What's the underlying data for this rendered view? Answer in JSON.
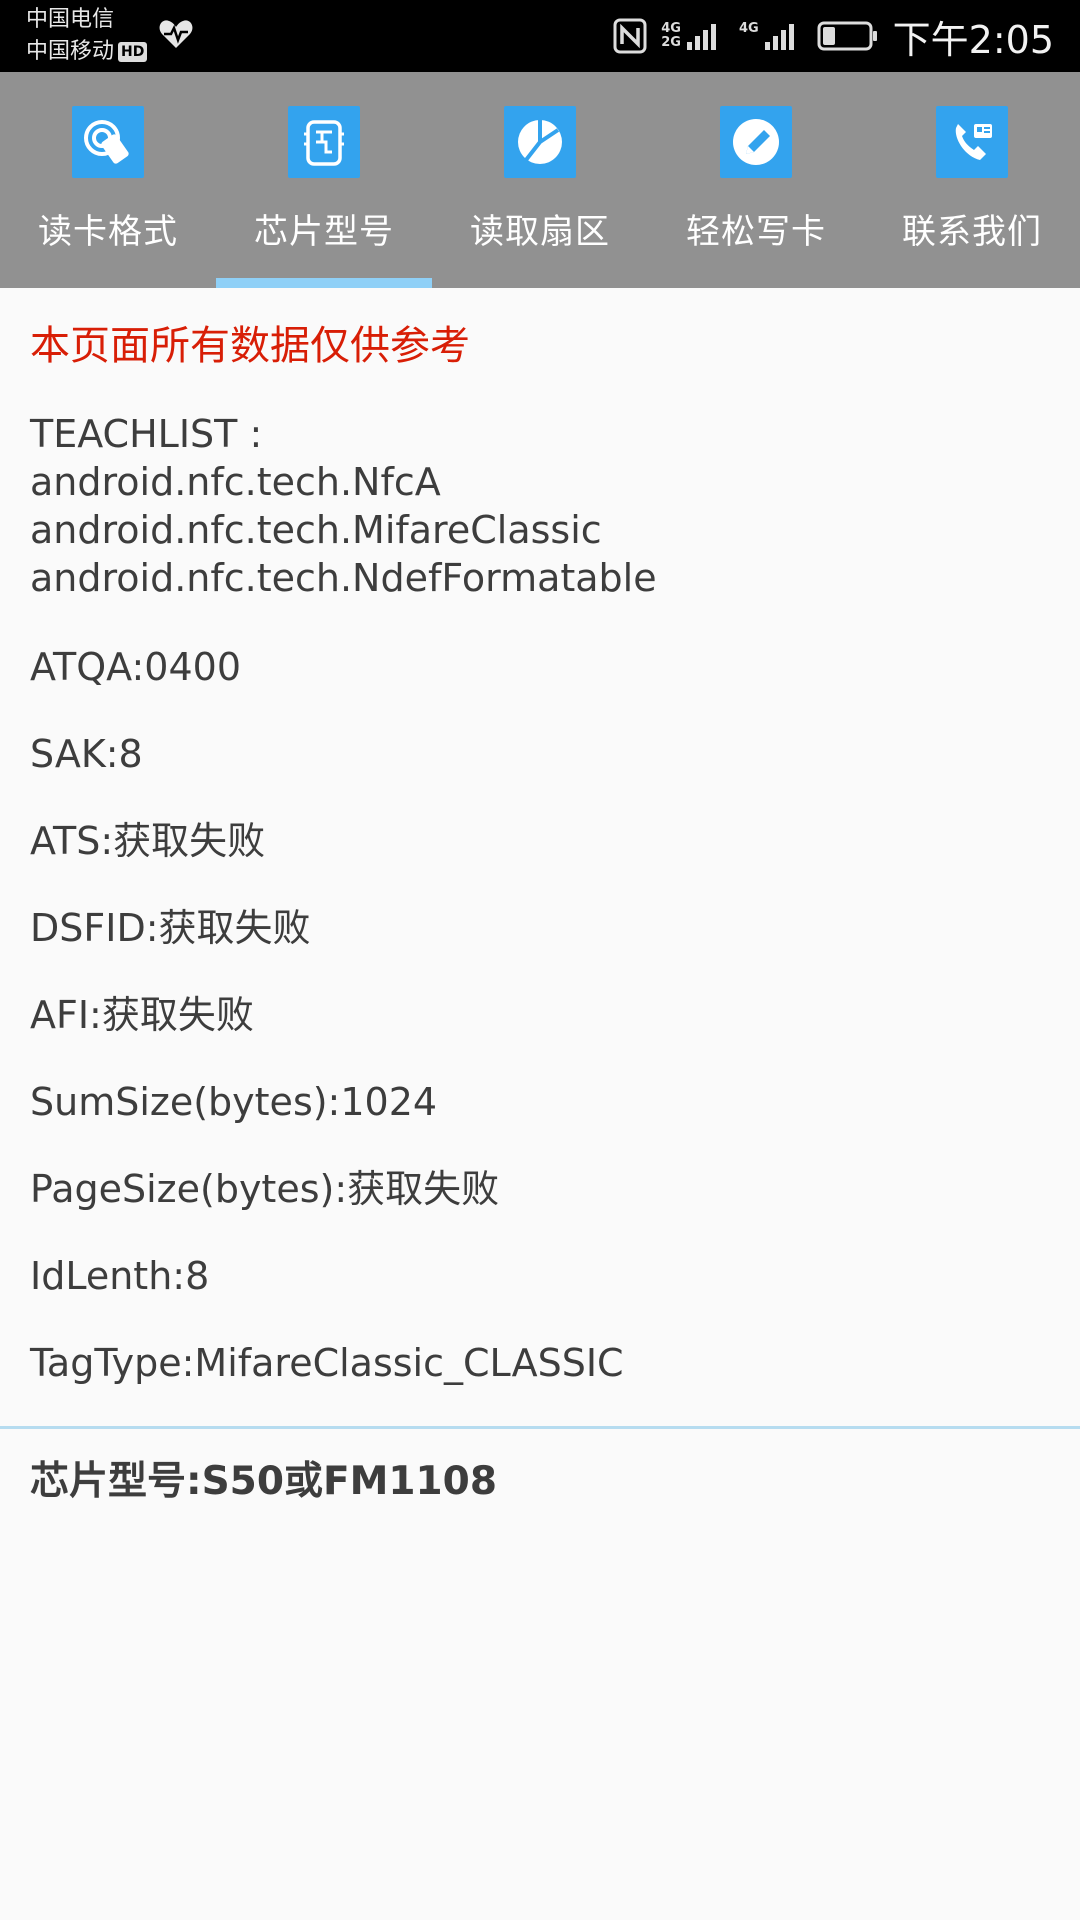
{
  "status_bar": {
    "carrier_1": "中国电信",
    "carrier_2": "中国移动",
    "hd_badge": "HD",
    "network_top": "4G",
    "network_bottom": "2G",
    "network_2": "4G",
    "time": "下午2:05"
  },
  "tabs": [
    {
      "label": "读卡格式",
      "icon": "nfc-card-icon"
    },
    {
      "label": "芯片型号",
      "icon": "chip-icon",
      "selected": true
    },
    {
      "label": "读取扇区",
      "icon": "pie-chart-icon"
    },
    {
      "label": "轻松写卡",
      "icon": "pencil-icon"
    },
    {
      "label": "联系我们",
      "icon": "contact-phone-icon"
    }
  ],
  "content": {
    "notice": "本页面所有数据仅供参考",
    "techlist_header": "TEACHLIST :",
    "tech_1": "android.nfc.tech.NfcA",
    "tech_2": "android.nfc.tech.MifareClassic",
    "tech_3": "android.nfc.tech.NdefFormatable",
    "atqa": "ATQA:0400",
    "sak": "SAK:8",
    "ats": "ATS:获取失败",
    "dsfid": "DSFID:获取失败",
    "afi": "AFI:获取失败",
    "sum_size": "SumSize(bytes):1024",
    "page_size": "PageSize(bytes):获取失败",
    "id_length": "IdLenth:8",
    "tag_type": "TagType:MifareClassic_CLASSIC",
    "chip_result": "芯片型号:S50或FM1108"
  },
  "colors": {
    "tab_bar": "#919191",
    "tab_icon_bg": "#33a3ee",
    "tab_indicator": "#8fd0f7",
    "notice_text": "#d81e06",
    "body_text": "#3d3d3d",
    "divider": "#b6dcf0"
  }
}
